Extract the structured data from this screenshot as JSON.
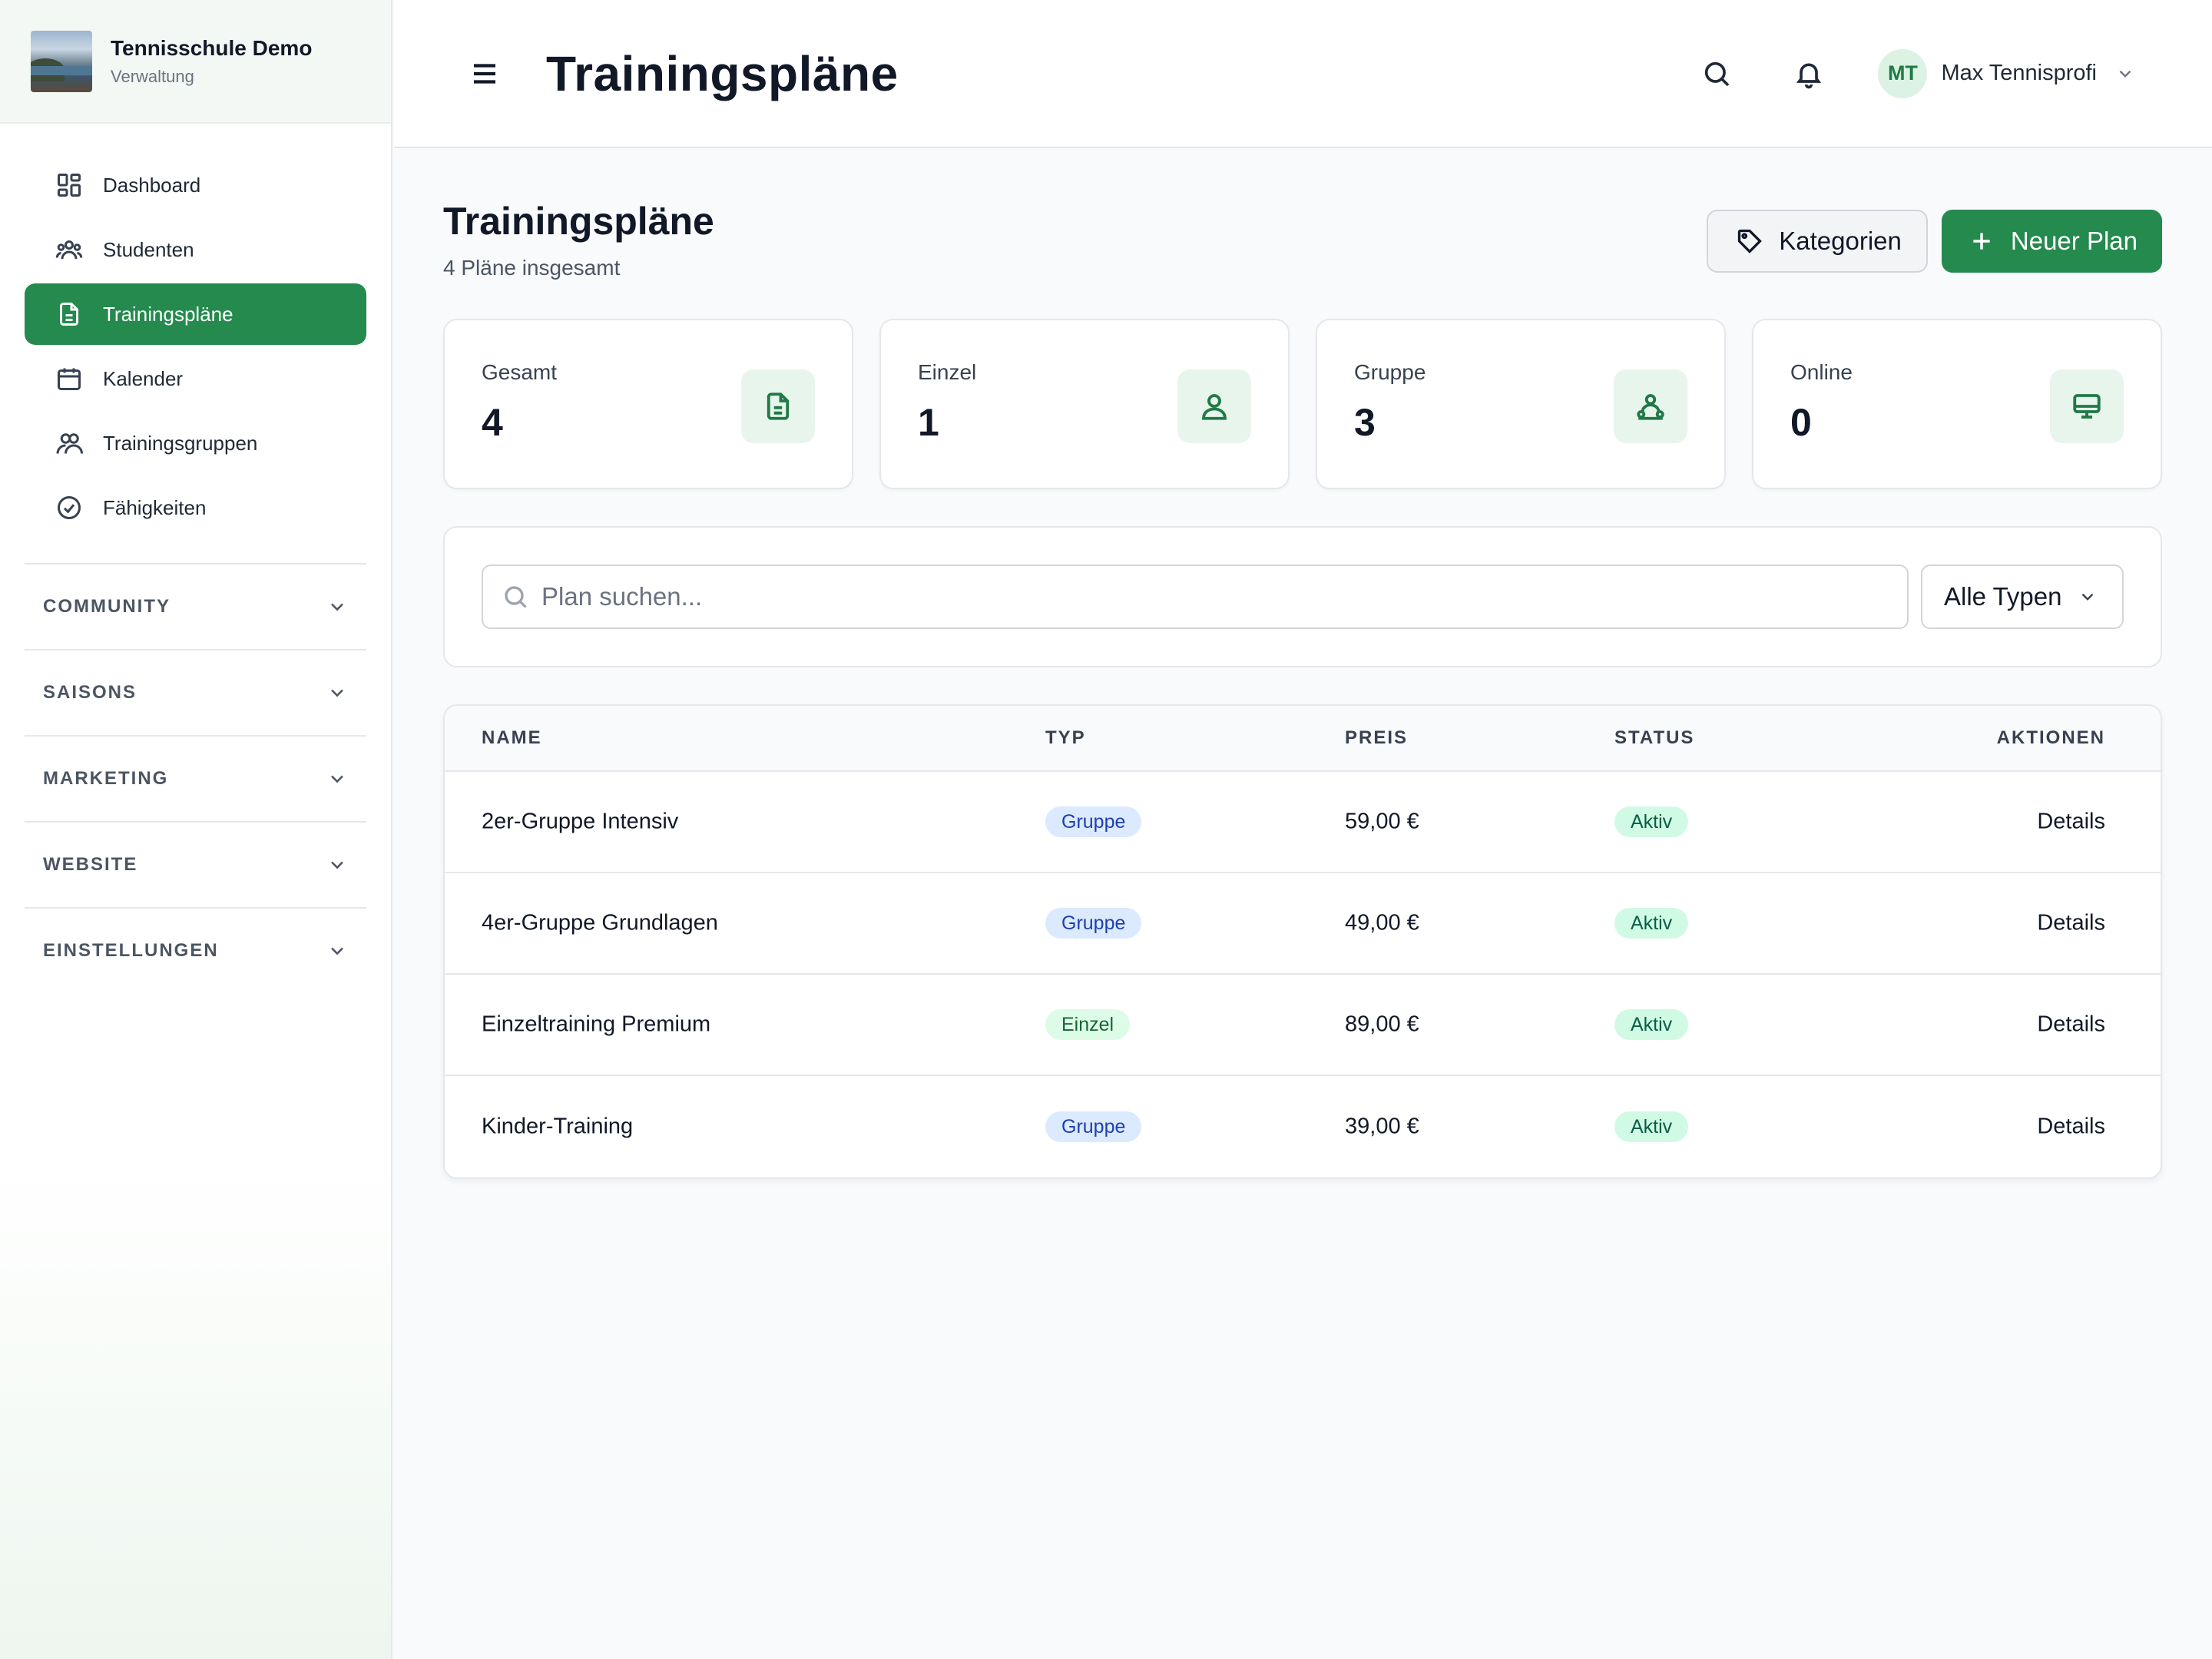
{
  "brand": {
    "name": "Tennisschule Demo",
    "subtitle": "Verwaltung"
  },
  "sidebar": {
    "items": [
      {
        "label": "Dashboard",
        "icon": "layout-dashboard-icon"
      },
      {
        "label": "Studenten",
        "icon": "users-icon"
      },
      {
        "label": "Trainingspläne",
        "icon": "file-text-icon",
        "active": true
      },
      {
        "label": "Kalender",
        "icon": "calendar-icon"
      },
      {
        "label": "Trainingsgruppen",
        "icon": "user-group-icon"
      },
      {
        "label": "Fähigkeiten",
        "icon": "check-circle-icon"
      }
    ],
    "sections": [
      {
        "label": "COMMUNITY"
      },
      {
        "label": "SAISONS"
      },
      {
        "label": "MARKETING"
      },
      {
        "label": "WEBSITE"
      },
      {
        "label": "EINSTELLUNGEN"
      }
    ]
  },
  "header": {
    "title": "Trainingspläne",
    "user": {
      "initials": "MT",
      "name": "Max Tennisprofi"
    }
  },
  "page": {
    "title": "Trainingspläne",
    "subtitle": "4 Pläne insgesamt",
    "categories_button": "Kategorien",
    "new_button": "Neuer Plan"
  },
  "stats": [
    {
      "label": "Gesamt",
      "value": "4",
      "icon": "file-text-icon"
    },
    {
      "label": "Einzel",
      "value": "1",
      "icon": "user-icon"
    },
    {
      "label": "Gruppe",
      "value": "3",
      "icon": "group-icon"
    },
    {
      "label": "Online",
      "value": "0",
      "icon": "monitor-icon"
    }
  ],
  "filters": {
    "search_placeholder": "Plan suchen...",
    "type_select": "Alle Typen"
  },
  "table": {
    "columns": [
      "NAME",
      "TYP",
      "PREIS",
      "STATUS",
      "AKTIONEN"
    ],
    "rows": [
      {
        "name": "2er-Gruppe Intensiv",
        "type": "Gruppe",
        "price": "59,00 €",
        "status": "Aktiv",
        "action": "Details"
      },
      {
        "name": "4er-Gruppe Grundlagen",
        "type": "Gruppe",
        "price": "49,00 €",
        "status": "Aktiv",
        "action": "Details"
      },
      {
        "name": "Einzeltraining Premium",
        "type": "Einzel",
        "price": "89,00 €",
        "status": "Aktiv",
        "action": "Details"
      },
      {
        "name": "Kinder-Training",
        "type": "Gruppe",
        "price": "39,00 €",
        "status": "Aktiv",
        "action": "Details"
      }
    ]
  },
  "colors": {
    "accent": "#248a4d",
    "badge_gruppe_bg": "#dbeafe",
    "badge_einzel_bg": "#dcfce7",
    "badge_aktiv_bg": "#d1fae5"
  }
}
